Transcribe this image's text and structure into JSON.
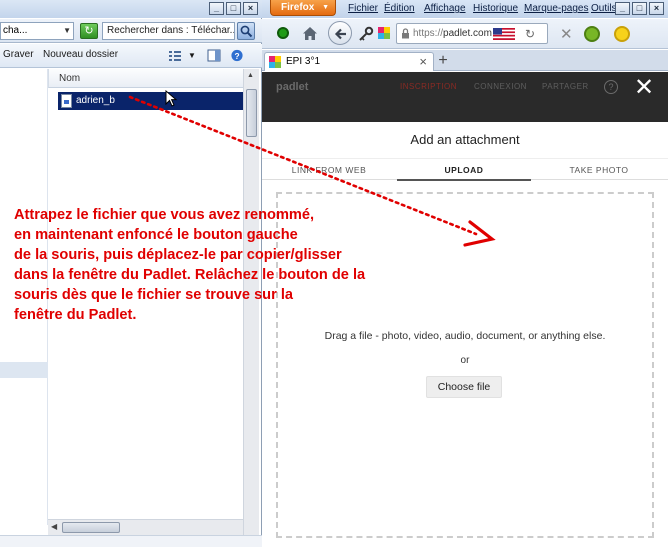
{
  "explorer": {
    "address_path": "cha...",
    "search_placeholder": "Rechercher dans : Téléchar...",
    "toolbar": {
      "burn_label": "Graver",
      "new_folder_label": "Nouveau dossier"
    },
    "column_name": "Nom",
    "selected_file": "adrien_b"
  },
  "firefox": {
    "app_button": "Firefox",
    "menu": [
      "Fichier",
      "Édition",
      "Affichage",
      "Historique",
      "Marque-pages",
      "Outils"
    ],
    "url_scheme": "https://",
    "url_host": "padlet.com",
    "tab_title": "EPI 3°1",
    "padlet_header": {
      "logo": "padlet",
      "links": [
        "INSCRIPTION",
        "CONNEXION",
        "PARTAGER"
      ],
      "help": "?"
    },
    "dialog": {
      "title": "Add an attachment",
      "tabs": [
        "LINK FROM WEB",
        "UPLOAD",
        "TAKE PHOTO"
      ],
      "active_tab": "UPLOAD",
      "drop_text": "Drag a file - photo, video, audio, document, or anything else.",
      "or_text": "or",
      "choose_button": "Choose file"
    }
  },
  "annotation": {
    "lines": [
      "Attrapez le fichier que vous avez renommé,",
      "en maintenant enfoncé le bouton gauche",
      "de la souris, puis déplacez-le par copier/glisser",
      "dans la fenêtre du Padlet. Relâchez le bouton de la",
      "souris dès que le fichier se trouve sur la",
      "fenêtre du Padlet."
    ],
    "color": "#e00000"
  },
  "colors": {
    "selection": "#0a246a",
    "firefox_orange": "#e46b10",
    "padlet_dark": "#2a2a2a",
    "padlet_accent": "#b3261e"
  }
}
